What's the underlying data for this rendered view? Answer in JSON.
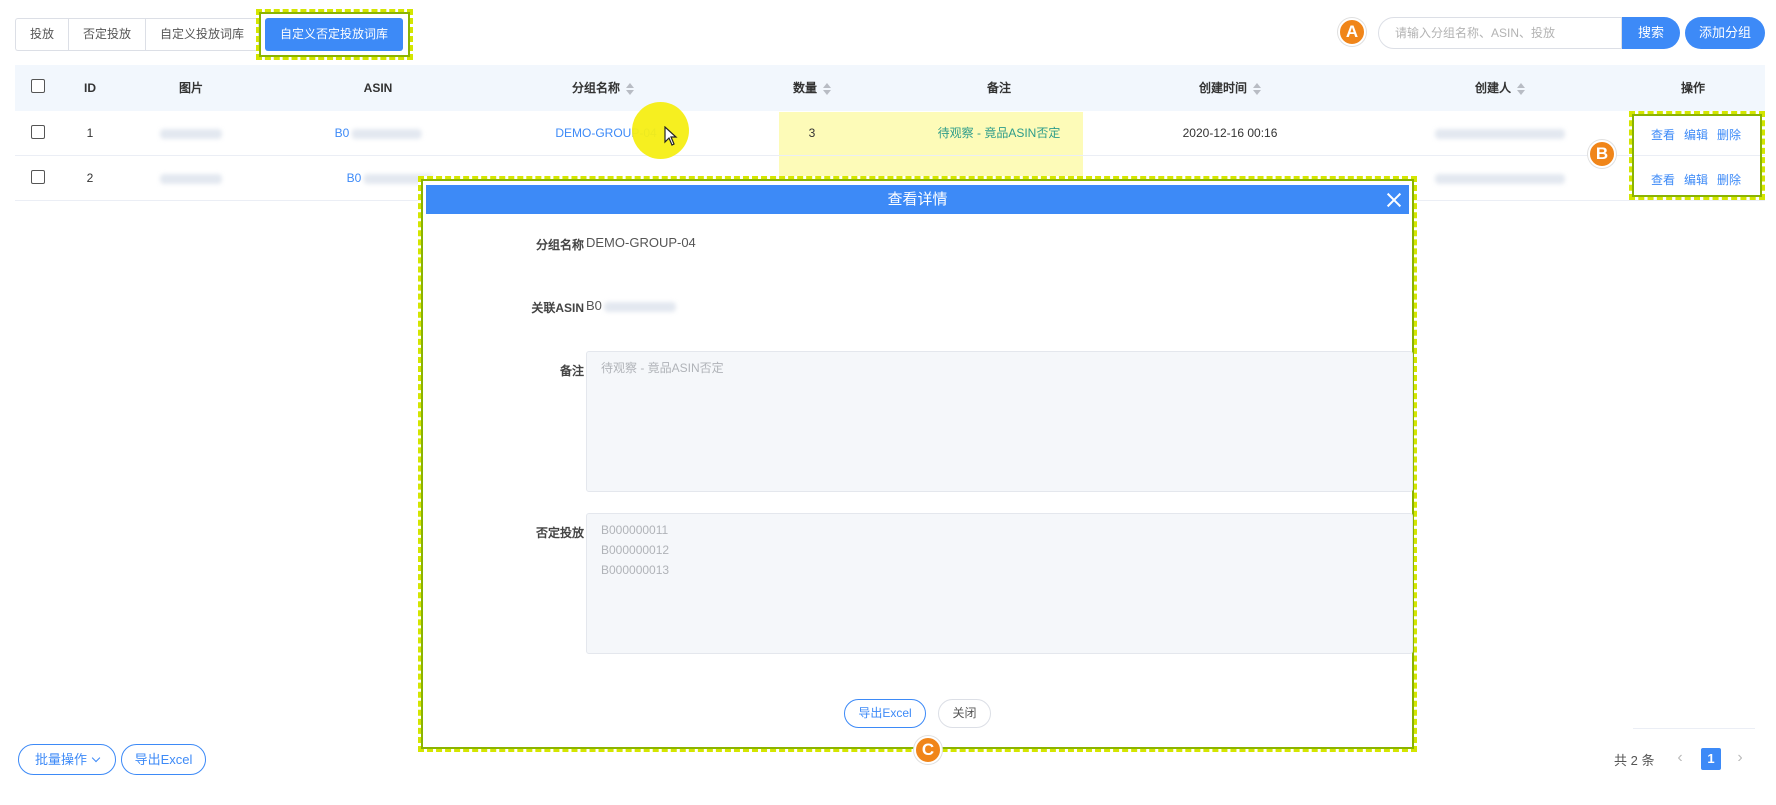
{
  "tabs": [
    {
      "label": "投放",
      "active": false
    },
    {
      "label": "否定投放",
      "active": false
    },
    {
      "label": "自定义投放词库",
      "active": false
    },
    {
      "label": "自定义否定投放词库",
      "active": true
    }
  ],
  "markers": {
    "a": "A",
    "b": "B",
    "c": "C"
  },
  "search": {
    "placeholder": "请输入分组名称、ASIN、投放",
    "button": "搜索"
  },
  "add_group": "添加分组",
  "table": {
    "columns": [
      "ID",
      "图片",
      "ASIN",
      "分组名称",
      "数量",
      "备注",
      "创建时间",
      "创建人",
      "操作"
    ],
    "rows": [
      {
        "id": "1",
        "asin": "B0",
        "group": "DEMO-GROUP-04",
        "count": "3",
        "note": "待观察 - 竟品ASIN否定",
        "created": "2020-12-16 00:16"
      },
      {
        "id": "2",
        "asin": "B0"
      }
    ],
    "actions": {
      "view": "查看",
      "edit": "编辑",
      "delete": "删除"
    }
  },
  "modal": {
    "title": "查看详情",
    "group_label": "分组名称",
    "group_value": "DEMO-GROUP-04",
    "asin_label": "关联ASIN",
    "asin_value": "B0",
    "note_label": "备注",
    "note_value": "待观察 - 竟品ASIN否定",
    "negative_label": "否定投放",
    "negative_values": [
      "B000000011",
      "B000000012",
      "B000000013"
    ],
    "export_button": "导出Excel",
    "close_button": "关闭"
  },
  "footer": {
    "batch_button": "批量操作",
    "export_button": "导出Excel",
    "total": "共 2 条",
    "current_page": "1",
    "prev": "‹",
    "next": "›"
  },
  "colors": {
    "primary": "#3d8af7",
    "highlight": "#fdfbb8",
    "marker": "#f08519",
    "annotation": "#d4e600"
  }
}
